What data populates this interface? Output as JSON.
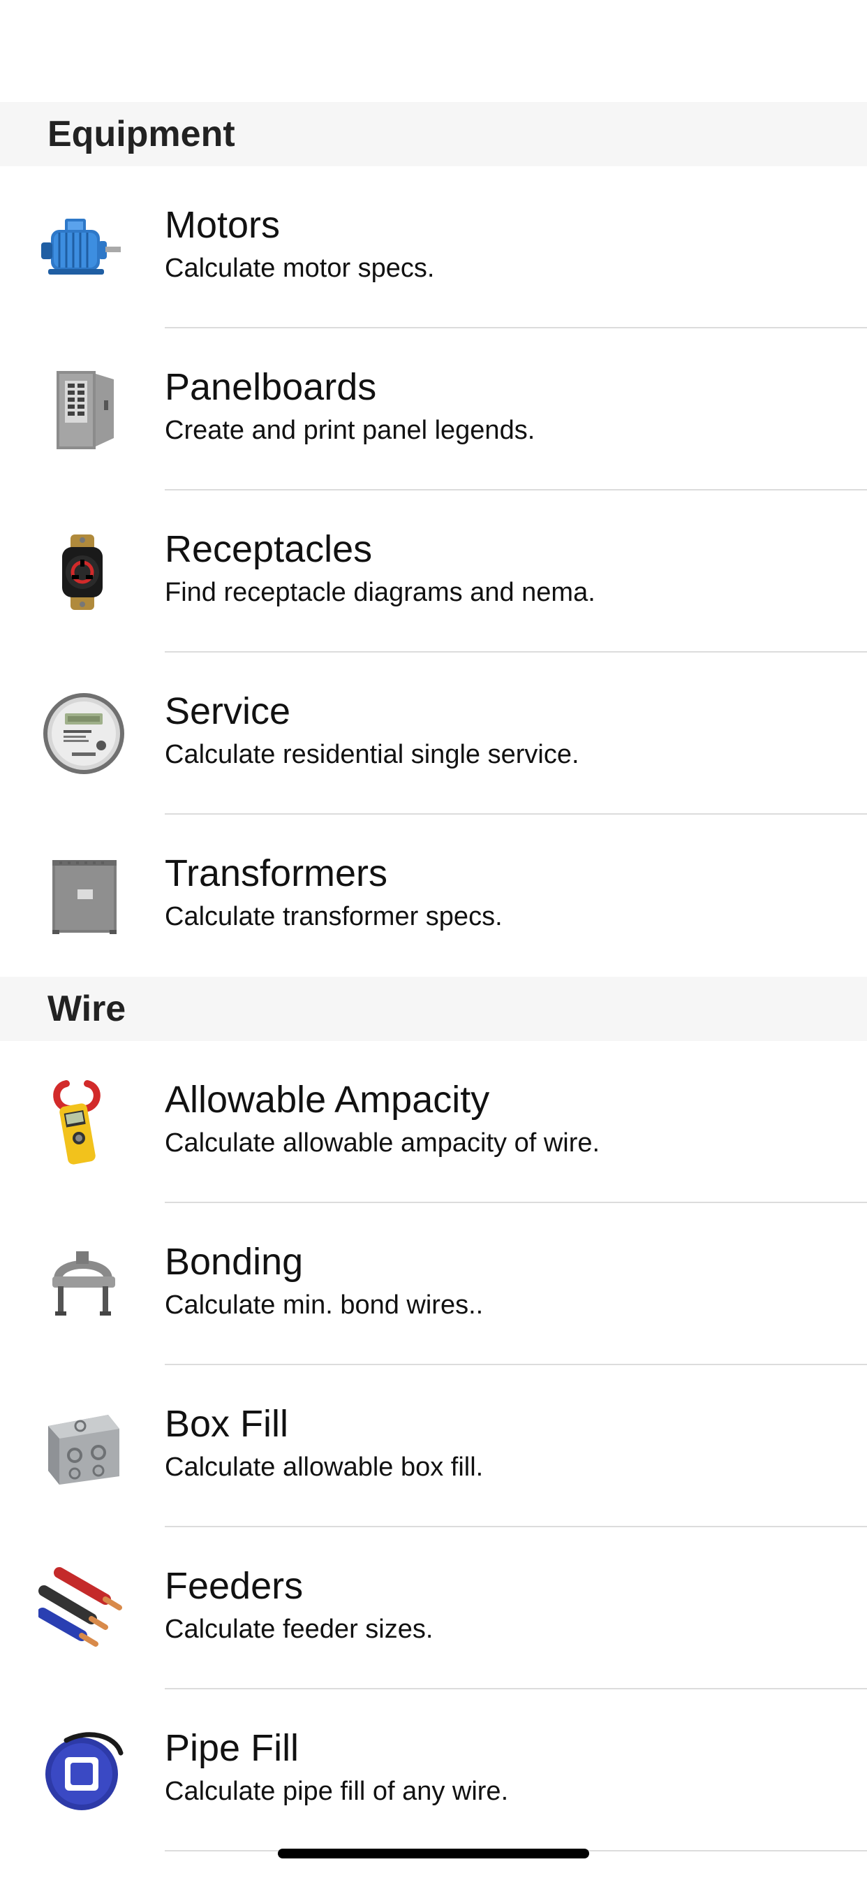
{
  "sections": [
    {
      "title": "Equipment",
      "items": [
        {
          "title": "Motors",
          "subtitle": "Calculate motor specs.",
          "icon": "motor-icon"
        },
        {
          "title": "Panelboards",
          "subtitle": "Create and print panel legends.",
          "icon": "panelboard-icon"
        },
        {
          "title": "Receptacles",
          "subtitle": "Find receptacle diagrams and nema.",
          "icon": "receptacle-icon"
        },
        {
          "title": "Service",
          "subtitle": "Calculate residential single service.",
          "icon": "meter-icon"
        },
        {
          "title": "Transformers",
          "subtitle": "Calculate transformer specs.",
          "icon": "transformer-icon"
        }
      ]
    },
    {
      "title": "Wire",
      "items": [
        {
          "title": "Allowable Ampacity",
          "subtitle": "Calculate allowable ampacity of wire.",
          "icon": "clamp-meter-icon"
        },
        {
          "title": "Bonding",
          "subtitle": "Calculate min. bond wires..",
          "icon": "bond-clamp-icon"
        },
        {
          "title": "Box Fill",
          "subtitle": "Calculate allowable box fill.",
          "icon": "junction-box-icon"
        },
        {
          "title": "Feeders",
          "subtitle": "Calculate feeder sizes.",
          "icon": "wires-icon"
        },
        {
          "title": "Pipe Fill",
          "subtitle": "Calculate pipe fill of any wire.",
          "icon": "fish-tape-icon"
        }
      ]
    }
  ],
  "colors": {
    "section_bg": "#f6f6f6",
    "separator": "#dcdcdc"
  }
}
